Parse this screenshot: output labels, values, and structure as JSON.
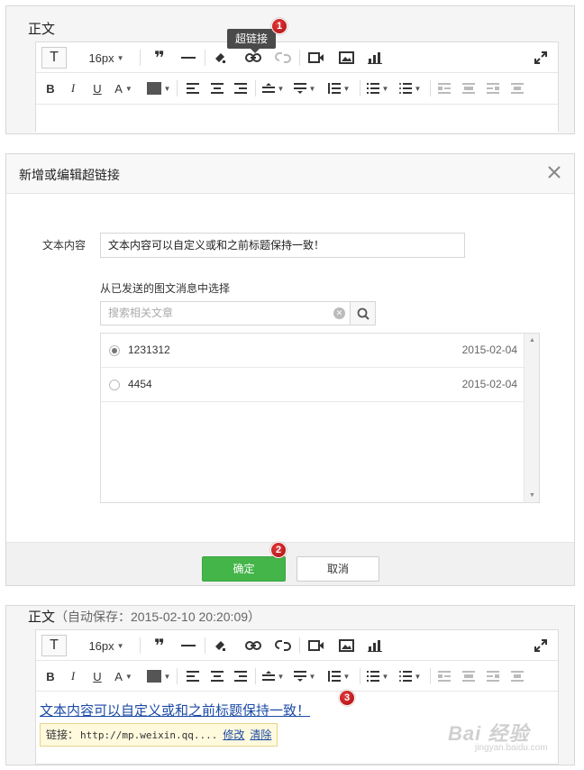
{
  "editor_top": {
    "title": "正文",
    "font_size": "16px",
    "tooltip": "超链接",
    "step": "1"
  },
  "dialog": {
    "title": "新增或编辑超链接",
    "text_label": "文本内容",
    "text_value": "文本内容可以自定义或和之前标题保持一致！",
    "section_label": "从已发送的图文消息中选择",
    "search_placeholder": "搜索相关文章",
    "items": [
      {
        "name": "1231312",
        "date": "2015-02-04",
        "selected": true
      },
      {
        "name": "4454",
        "date": "2015-02-04",
        "selected": false
      }
    ],
    "ok_label": "确定",
    "cancel_label": "取消",
    "step": "2"
  },
  "editor_bottom": {
    "title": "正文",
    "autosave": "（自动保存：2015-02-10 20:20:09）",
    "font_size": "16px",
    "link_text": "文本内容可以自定义或和之前标题保持一致！",
    "link_label": "链接：",
    "link_url": "http://mp.weixin.qq....",
    "edit_label": "修改",
    "clear_label": "清除",
    "step": "3"
  },
  "watermark": {
    "main": "Bai 经验",
    "sub": "jingyan.baidu.com"
  },
  "colors": {
    "primary_green": "#44b549",
    "link_blue": "#1b4aa6",
    "badge_red": "#d3202a"
  }
}
